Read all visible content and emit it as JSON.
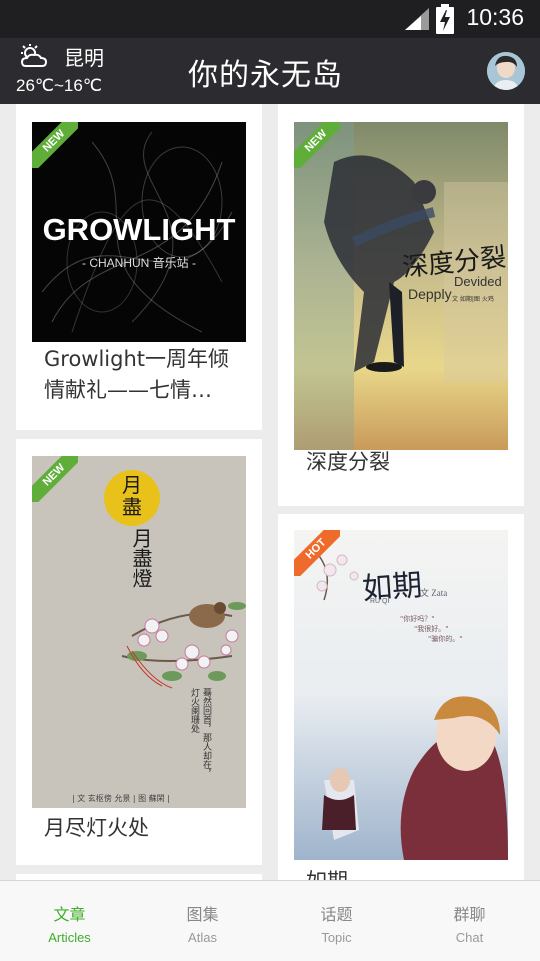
{
  "status_bar": {
    "time": "10:36"
  },
  "header": {
    "city": "昆明",
    "temperature": "26℃~16℃",
    "title": "你的永无岛"
  },
  "cards": [
    {
      "title": "Growlight一周年倾情献礼——七情…",
      "badge": "NEW",
      "cover_text": {
        "main": "GROWLIGHT",
        "sub": "- CHANHUN 音乐站 -"
      }
    },
    {
      "title": "深度分裂",
      "badge": "NEW",
      "cover_text": {
        "main": "深度分裂",
        "en1": "Devided",
        "en2": "Depply",
        "credit": "文 如期|图 火鸡"
      }
    },
    {
      "title": "月尽灯火处",
      "badge": "NEW",
      "cover_text": {
        "main": "月盡燈火處",
        "moon": "月\n盡",
        "poem": "蓦然回首，那人却在，灯火阑珊处",
        "credit": "| 文 玄枢傍 允景 | 图 蘇閑 |"
      }
    },
    {
      "title": "如期",
      "badge": "HOT",
      "cover_text": {
        "main": "如期",
        "pinyin": "RU QI",
        "credit": "文 Zata",
        "q1": "\"你好吗？\"",
        "q2": "\"我很好。\"",
        "q3": "\"骗你的。\""
      }
    }
  ],
  "bottom_nav": [
    {
      "cn": "文章",
      "en": "Articles",
      "active": true
    },
    {
      "cn": "图集",
      "en": "Atlas",
      "active": false
    },
    {
      "cn": "话题",
      "en": "Topic",
      "active": false
    },
    {
      "cn": "群聊",
      "en": "Chat",
      "active": false
    }
  ],
  "colors": {
    "accent": "#3fae2a",
    "header_bg": "#2c2c30",
    "new_badge": "#5fae3a",
    "hot_badge": "#ef6b2c"
  }
}
